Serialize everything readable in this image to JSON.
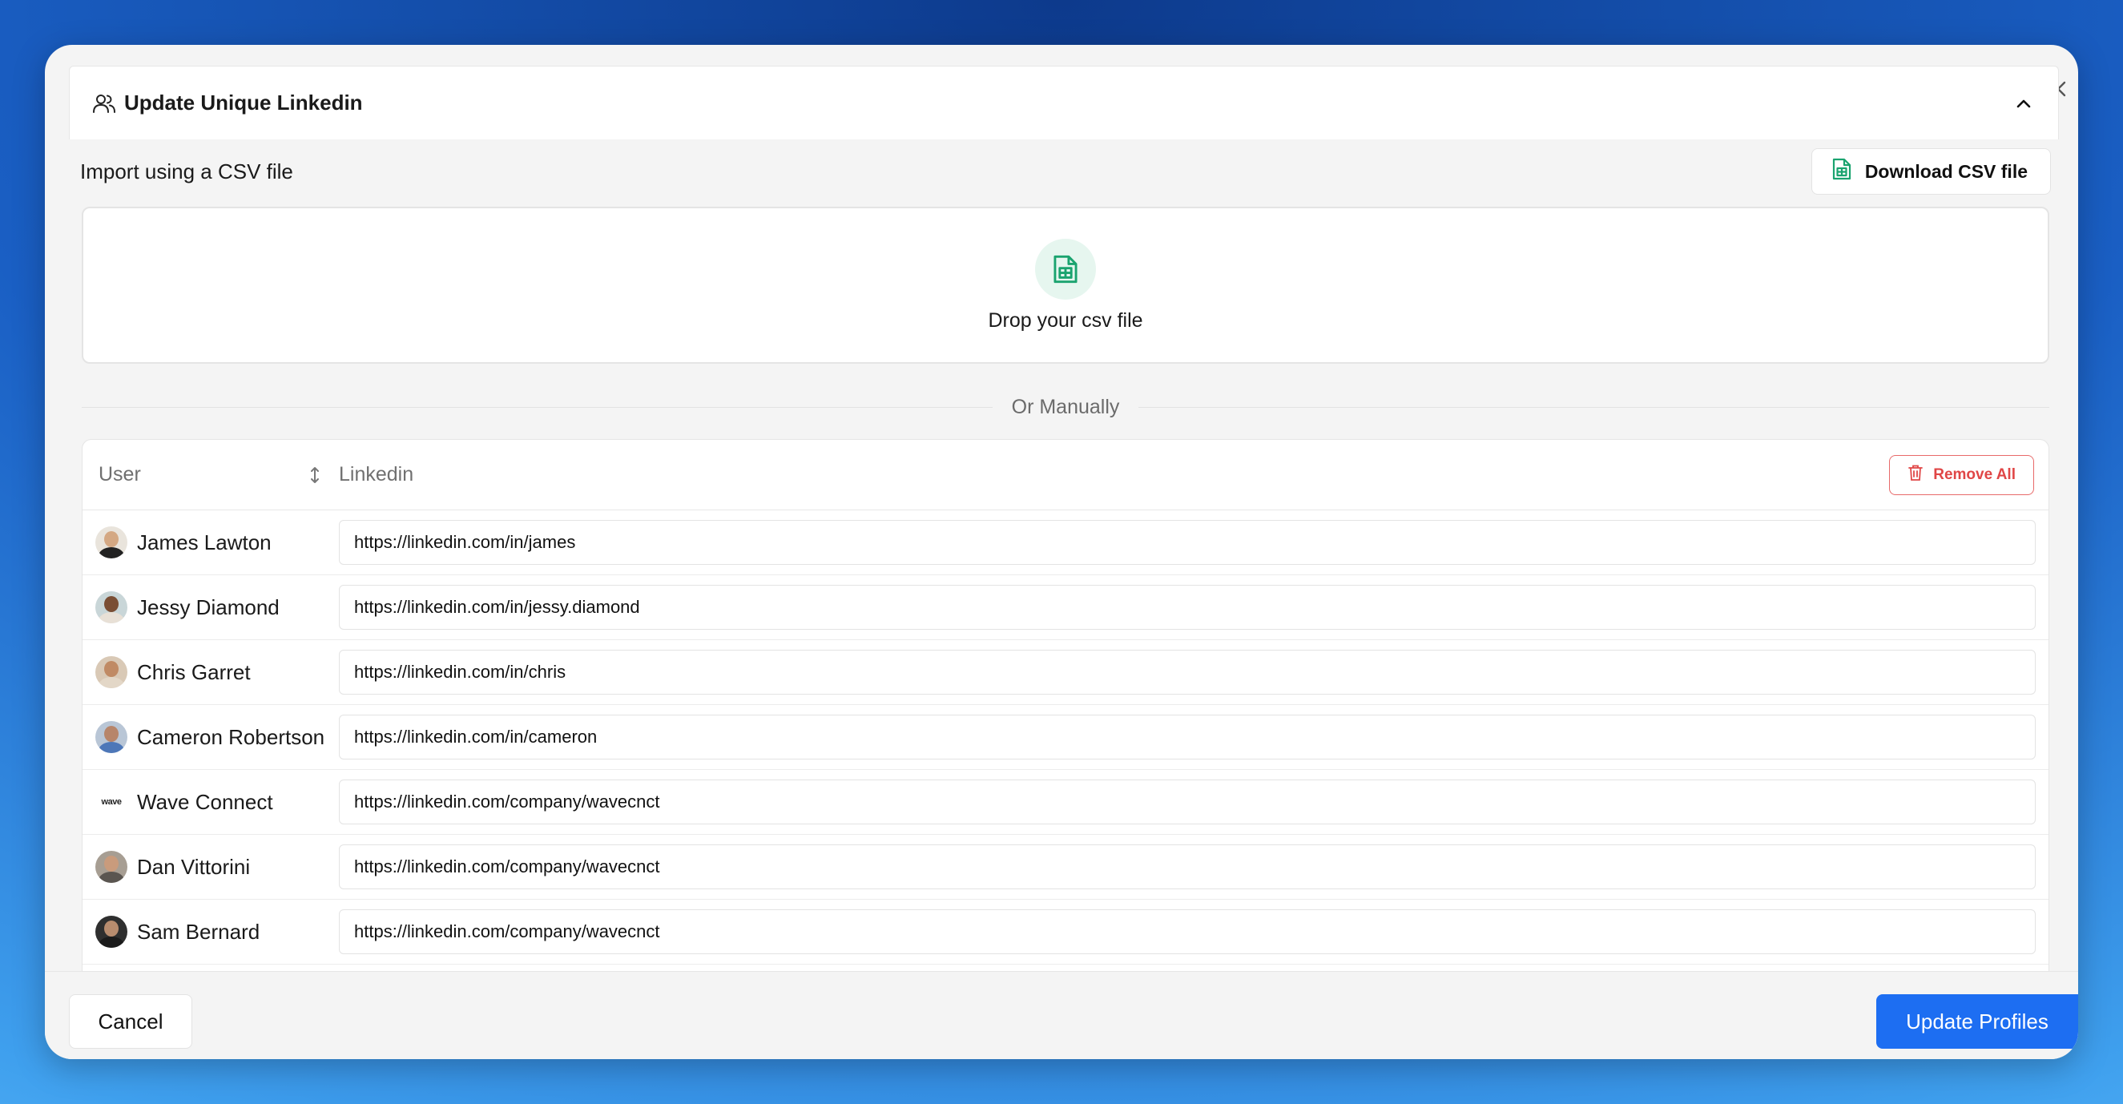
{
  "dialog": {
    "title": "Update Unique Linkedin",
    "import_label": "Import using a CSV file",
    "download_label": "Download CSV file",
    "drop_text": "Drop your csv file",
    "divider_text": "Or Manually"
  },
  "table": {
    "col_user": "User",
    "col_linkedin": "Linkedin",
    "remove_all_label": "Remove All",
    "rows": [
      {
        "name": "James Lawton",
        "url": "https://linkedin.com/in/james",
        "avatar": "avatar-1"
      },
      {
        "name": "Jessy Diamond",
        "url": "https://linkedin.com/in/jessy.diamond",
        "avatar": "avatar-2"
      },
      {
        "name": "Chris Garret",
        "url": "https://linkedin.com/in/chris",
        "avatar": "avatar-3"
      },
      {
        "name": "Cameron Robertson",
        "url": "https://linkedin.com/in/cameron",
        "avatar": "avatar-4"
      },
      {
        "name": "Wave Connect",
        "url": "https://linkedin.com/company/wavecnct",
        "avatar": "wave-logo",
        "logo_text": "wave"
      },
      {
        "name": "Dan Vittorini",
        "url": "https://linkedin.com/company/wavecnct",
        "avatar": "avatar-6"
      },
      {
        "name": "Sam Bernard",
        "url": "https://linkedin.com/company/wavecnct",
        "avatar": "avatar-7"
      }
    ]
  },
  "footer": {
    "cancel_label": "Cancel",
    "update_label": "Update Profiles"
  },
  "colors": {
    "primary": "#1d6ef2",
    "danger": "#e04646",
    "csv_green": "#1aa36f"
  }
}
